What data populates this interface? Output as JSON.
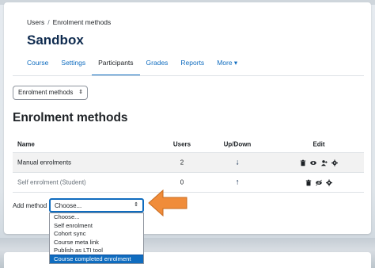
{
  "breadcrumb": {
    "items": [
      "Users",
      "Enrolment methods"
    ],
    "separator": "/"
  },
  "course": {
    "title": "Sandbox"
  },
  "nav": {
    "tabs": [
      {
        "label": "Course"
      },
      {
        "label": "Settings"
      },
      {
        "label": "Participants",
        "active": true
      },
      {
        "label": "Grades"
      },
      {
        "label": "Reports"
      },
      {
        "label": "More ▾"
      }
    ]
  },
  "page_select": {
    "value": "Enrolment methods",
    "arrow": "⇕"
  },
  "section": {
    "title": "Enrolment methods"
  },
  "table": {
    "headers": {
      "name": "Name",
      "users": "Users",
      "updown": "Up/Down",
      "edit": "Edit"
    },
    "rows": [
      {
        "name": "Manual enrolments",
        "users": "2",
        "updown": "↓",
        "edit_icons": [
          "trash-icon",
          "eye-icon",
          "enrol-users-icon",
          "settings-icon"
        ]
      },
      {
        "name": "Self enrolment (Student)",
        "users": "0",
        "updown": "↑",
        "edit_icons": [
          "trash-icon",
          "eye-slash-icon",
          "settings-icon"
        ]
      }
    ]
  },
  "add_method": {
    "label": "Add method",
    "selected": "Choose...",
    "arrow": "⇕",
    "options": [
      "Choose...",
      "Self enrolment",
      "Cohort sync",
      "Course meta link",
      "Publish as LTI tool",
      "Course completed enrolment"
    ],
    "highlighted": "Course completed enrolment"
  },
  "colors": {
    "accent": "#0f6cbf",
    "title": "#0f2b4f",
    "pointer": "#f08c3a"
  }
}
